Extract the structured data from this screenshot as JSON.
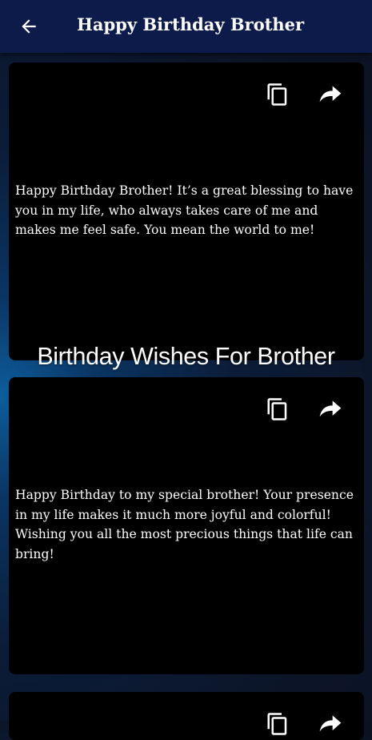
{
  "app_bar": {
    "title": "Happy Birthday Brother",
    "back_icon": "arrow-left-icon"
  },
  "banner": {
    "text": "Birthday Wishes For Brother"
  },
  "wishes": [
    {
      "text": "Happy Birthday Brother! It’s a great blessing to have you in my life, who always takes care of me and makes me feel safe. You mean the world to me!",
      "actions": [
        "copy-icon",
        "share-icon"
      ]
    },
    {
      "text": "Happy Birthday to my special brother! Your presence in my life makes it much more joyful and colorful! Wishing you all the most precious things that life can bring!",
      "actions": [
        "copy-icon",
        "share-icon"
      ]
    },
    {
      "text": "",
      "actions": [
        "copy-icon",
        "share-icon"
      ]
    }
  ],
  "colors": {
    "app_bar": "#0d1b4b",
    "card": "#000000",
    "text": "#ffffff",
    "background_glow": "#0d5d9c"
  }
}
